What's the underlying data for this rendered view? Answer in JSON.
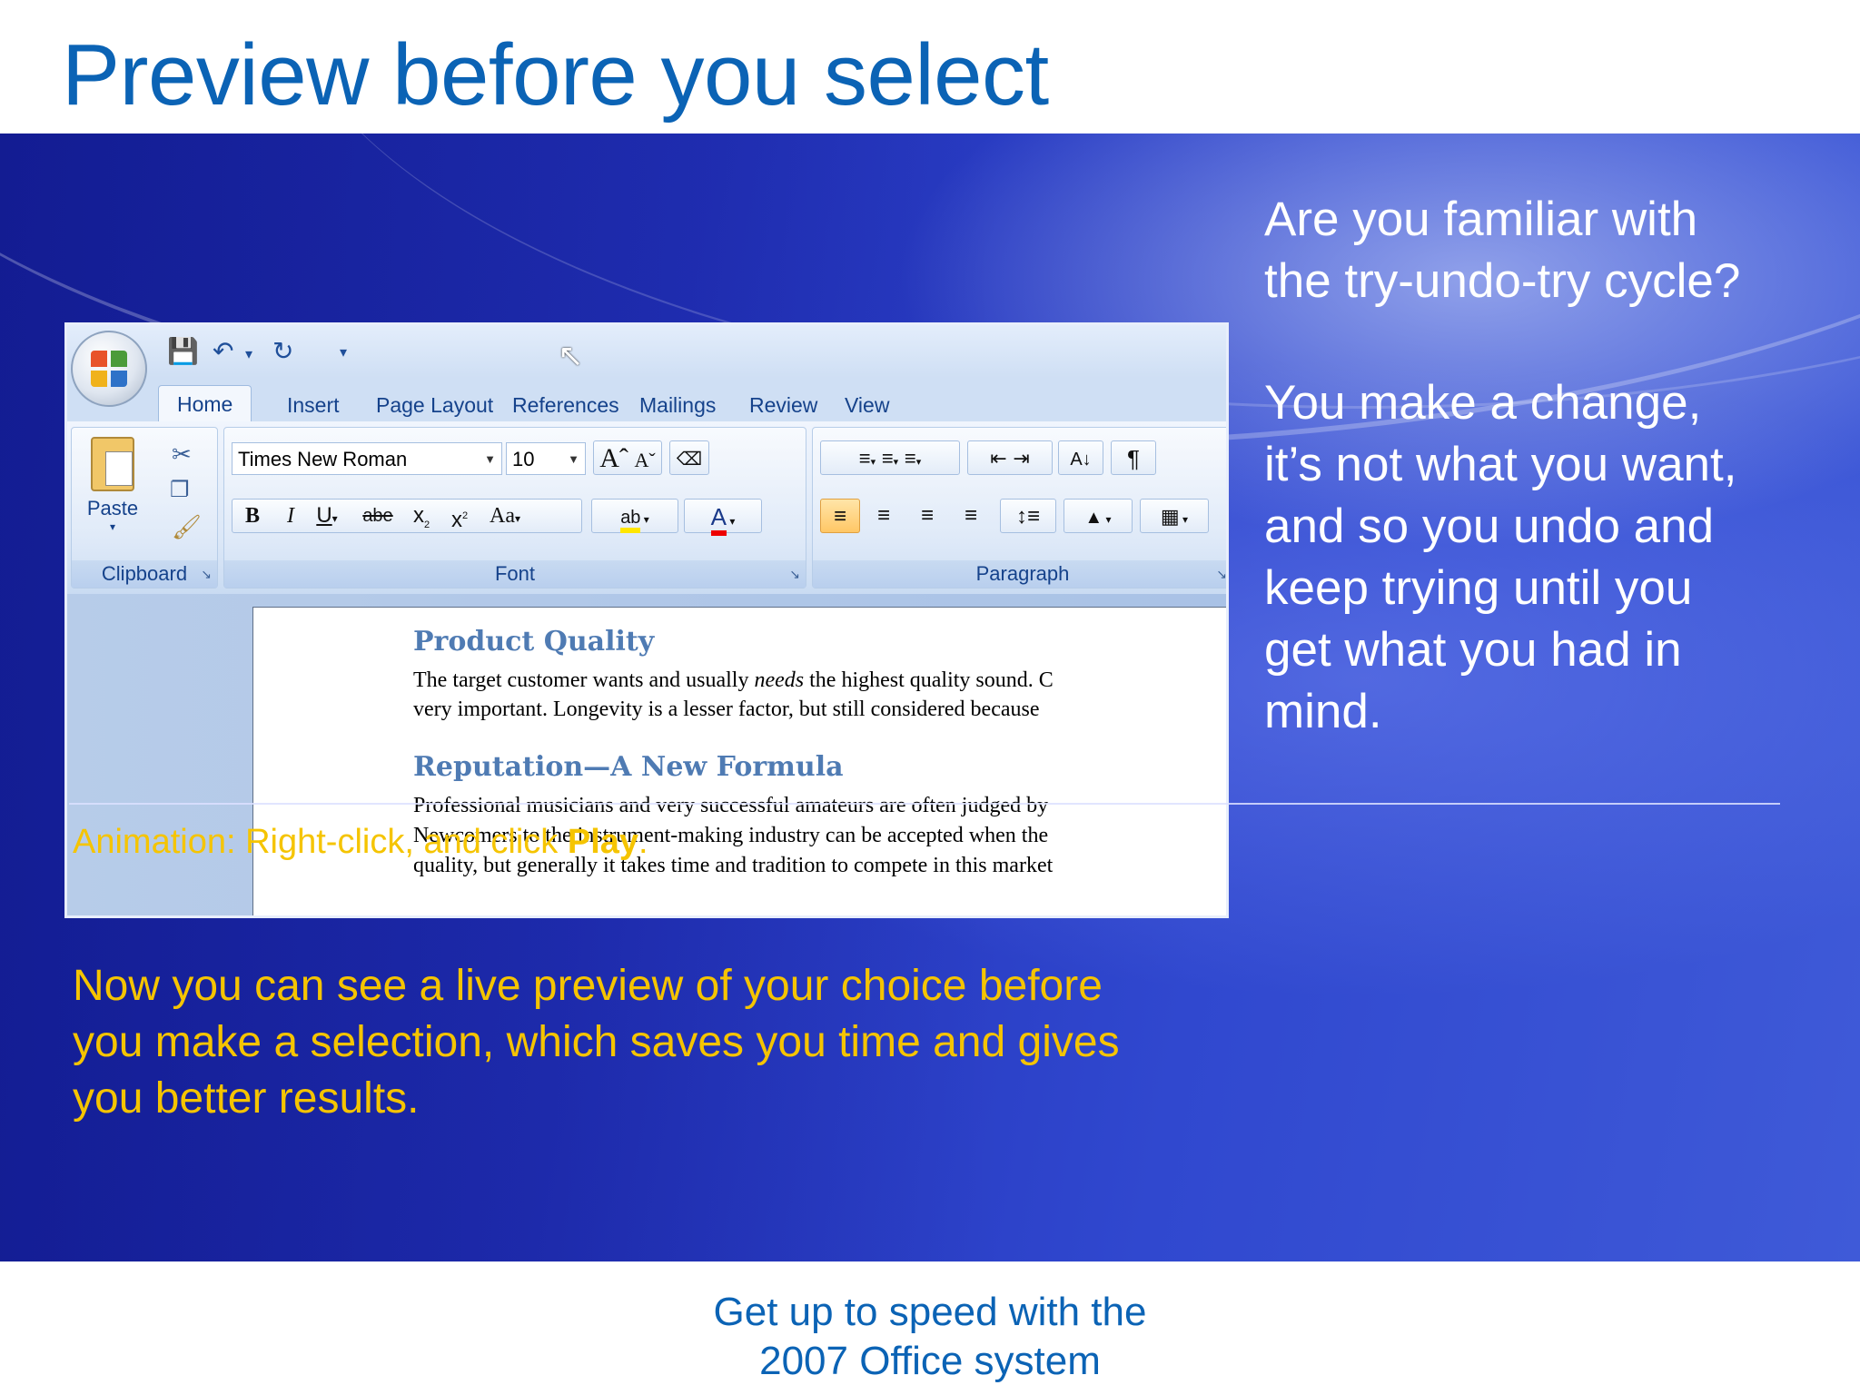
{
  "slide": {
    "title": "Preview before you select",
    "intro_line1": "Are you familiar with",
    "intro_line2": "the try-undo-try cycle?",
    "para_lines": [
      "You make a change,",
      "it’s not what you want,",
      "and so you undo and",
      "keep trying until you",
      "get what you had in",
      "mind."
    ],
    "animation_prefix": "Animation: Right-click, and click ",
    "animation_bold": "Play",
    "animation_suffix": ".",
    "summary_lines": [
      "Now you can see a live preview of your choice before",
      "you make a selection, which saves you time and gives",
      "you better results."
    ],
    "footer_line1": "Get up to speed with the",
    "footer_line2": "2007 Office system"
  },
  "ribbon": {
    "tabs": [
      "Home",
      "Insert",
      "Page Layout",
      "References",
      "Mailings",
      "Review",
      "View"
    ],
    "active_tab": "Home",
    "clipboard": {
      "paste_label": "Paste",
      "group_label": "Clipboard"
    },
    "font": {
      "font_name": "Times New Roman",
      "font_size": "10",
      "group_label": "Font"
    },
    "paragraph": {
      "group_label": "Paragraph"
    },
    "styles": {
      "preview_text": "Aa",
      "pilcrow": "¶"
    }
  },
  "document": {
    "heading1": "Product Quality",
    "p1_line1_a": "The target customer wants and usually ",
    "p1_line1_em": "needs",
    "p1_line1_b": " the highest quality sound. C",
    "p1_line2": "very important.  Longevity is a lesser factor, but still considered because",
    "heading2": "Reputation—A New Formula",
    "p2_line1": "Professional musicians and very successful amateurs are often judged by",
    "p2_line2": "Newcomers to the instrument-making industry can be accepted when the",
    "p2_line3": "quality, but generally it takes time and tradition to compete in this market"
  },
  "colors": {
    "title_blue": "#0b63b5",
    "accent_yellow": "#f5c400",
    "band_blue": "#2231b8"
  }
}
